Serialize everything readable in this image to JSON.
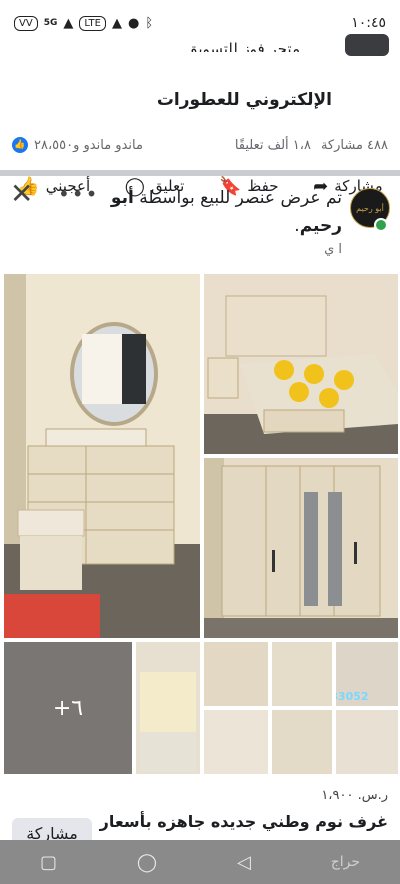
{
  "status_bar": {
    "time": "١٠:٤٥",
    "badge": "VV",
    "signal": "5G",
    "lte": "LTE"
  },
  "prev_post": {
    "title_top_partial": "متجر فوز للتسويق",
    "title": "الإلكتروني للعطورات",
    "reactions_text": "ماندو ماندو و٢٨،٥٥٠",
    "comments_text": "١،٨ ألف تعليقًا",
    "shares_text": "٤٨٨ مشاركة",
    "actions": {
      "like": "أعجبني",
      "comment": "تعليق",
      "save": "حفظ",
      "share": "مشاركة"
    }
  },
  "post": {
    "title_text": "تم عرض عنصر للبيع بواسطة",
    "author": "أبو رحيم",
    "author_tail": ".",
    "subtitle": "ا ي",
    "avatar_text": "أبو رحيم",
    "more_overlay": "+٦",
    "watermark": "0509283052"
  },
  "listing": {
    "price": "ر.س. ١،٩٠٠",
    "title": "غرف نوم وطني جديده جاهزه بأسعار",
    "share_label": "مشاركة"
  },
  "nav": {
    "brand": "حراج"
  },
  "colors": {
    "facebook_blue": "#1877f2",
    "divider": "#c9ccd1",
    "nav_bg": "#8a8a8a"
  }
}
